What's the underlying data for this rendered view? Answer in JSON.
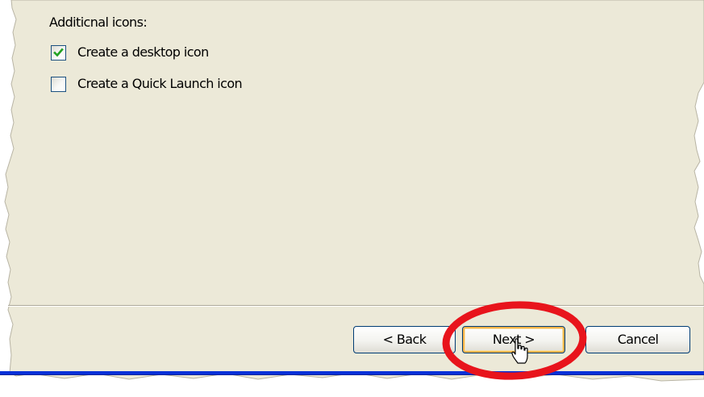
{
  "options": {
    "section_label": "Additicnal icons:",
    "items": [
      {
        "label": "Create a desktop icon",
        "checked": true
      },
      {
        "label": "Create a Quick Launch icon",
        "checked": false
      }
    ]
  },
  "buttons": {
    "back_label": "< Back",
    "next_label": "Next >",
    "cancel_label": "Cancel"
  },
  "colors": {
    "dialog_background": "#ece9d8",
    "checkmark": "#21a121",
    "checkbox_border": "#1c5180",
    "button_border": "#003c74",
    "default_button_highlight": "#f5b44a",
    "annotation_circle": "#e8141c",
    "taskbar_blue": "#0831d9"
  },
  "icons": {
    "checkmark": "checkmark-icon",
    "pointer": "hand-pointer-cursor-icon"
  }
}
